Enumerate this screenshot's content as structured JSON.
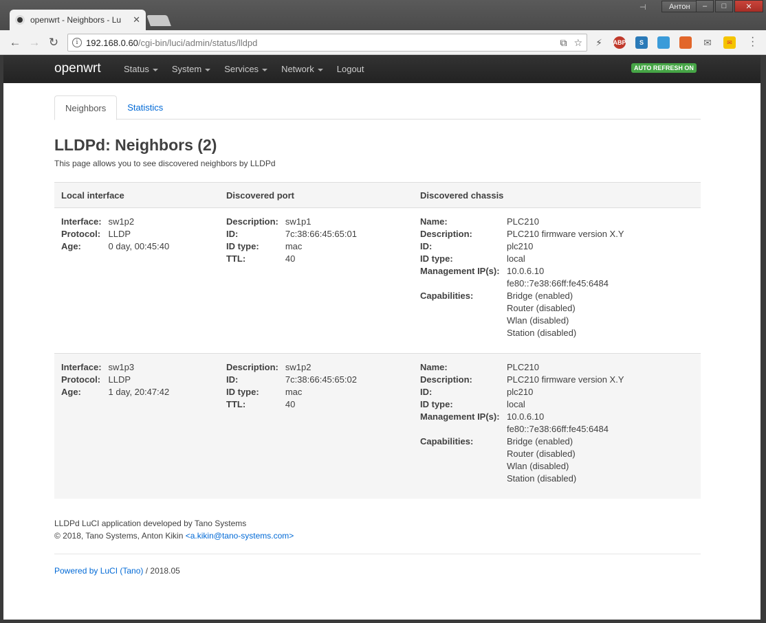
{
  "browser": {
    "tab_title": "openwrt - Neighbors - Lu",
    "url_host": "192.168.0.60",
    "url_path": "/cgi-bin/luci/admin/status/lldpd",
    "user": "Антон"
  },
  "header": {
    "brand": "openwrt",
    "nav": [
      {
        "label": "Status",
        "dropdown": true
      },
      {
        "label": "System",
        "dropdown": true
      },
      {
        "label": "Services",
        "dropdown": true
      },
      {
        "label": "Network",
        "dropdown": true
      },
      {
        "label": "Logout",
        "dropdown": false
      }
    ],
    "auto_refresh": "AUTO REFRESH ON"
  },
  "tabs": [
    {
      "label": "Neighbors",
      "active": true
    },
    {
      "label": "Statistics",
      "active": false
    }
  ],
  "page": {
    "title": "LLDPd: Neighbors (2)",
    "description": "This page allows you to see discovered neighbors by LLDPd"
  },
  "table": {
    "columns": [
      "Local interface",
      "Discovered port",
      "Discovered chassis"
    ],
    "rows": [
      {
        "local": {
          "Interface:": "sw1p2",
          "Protocol:": "LLDP",
          "Age:": "0 day, 00:45:40"
        },
        "port": {
          "Description:": "sw1p1",
          "ID:": "7c:38:66:45:65:01",
          "ID type:": "mac",
          "TTL:": "40"
        },
        "chassis": {
          "name": "PLC210",
          "description": "PLC210 firmware version X.Y",
          "id": "plc210",
          "id_type": "local",
          "mgmt_ips": [
            "10.0.6.10",
            "fe80::7e38:66ff:fe45:6484"
          ],
          "capabilities": [
            "Bridge (enabled)",
            "Router (disabled)",
            "Wlan (disabled)",
            "Station (disabled)"
          ]
        }
      },
      {
        "local": {
          "Interface:": "sw1p3",
          "Protocol:": "LLDP",
          "Age:": "1 day, 20:47:42"
        },
        "port": {
          "Description:": "sw1p2",
          "ID:": "7c:38:66:45:65:02",
          "ID type:": "mac",
          "TTL:": "40"
        },
        "chassis": {
          "name": "PLC210",
          "description": "PLC210 firmware version X.Y",
          "id": "plc210",
          "id_type": "local",
          "mgmt_ips": [
            "10.0.6.10",
            "fe80::7e38:66ff:fe45:6484"
          ],
          "capabilities": [
            "Bridge (enabled)",
            "Router (disabled)",
            "Wlan (disabled)",
            "Station (disabled)"
          ]
        }
      }
    ],
    "labels": {
      "interface": "Interface:",
      "protocol": "Protocol:",
      "age": "Age:",
      "description": "Description:",
      "id": "ID:",
      "id_type": "ID type:",
      "ttl": "TTL:",
      "name": "Name:",
      "mgmt": "Management IP(s):",
      "capabilities": "Capabilities:"
    }
  },
  "footer": {
    "line1": "LLDPd LuCI application developed by Tano Systems",
    "line2_prefix": "© 2018, Tano Systems, Anton Kikin ",
    "email_link": "<a.kikin@tano-systems.com>",
    "powered_link": "Powered by LuCI (Tano)",
    "powered_suffix": " / 2018.05"
  }
}
